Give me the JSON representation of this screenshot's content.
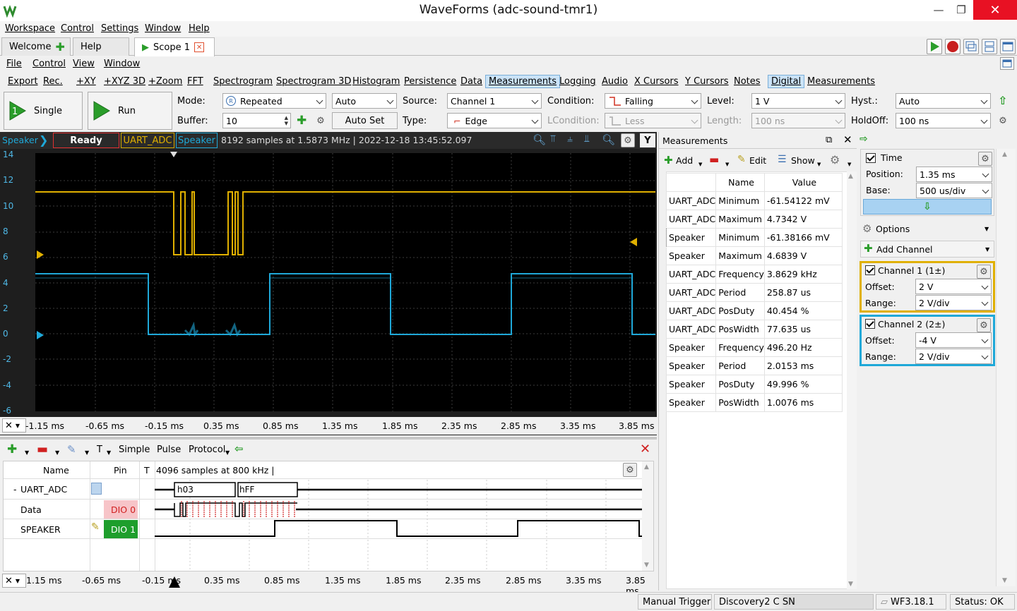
{
  "window": {
    "title": "WaveForms (adc-sound-tmr1)"
  },
  "menubar": [
    "Workspace",
    "Control",
    "Settings",
    "Window",
    "Help"
  ],
  "tabs": {
    "welcome": "Welcome",
    "help": "Help",
    "scope": "Scope 1"
  },
  "scope_menu": [
    "File",
    "Control",
    "View",
    "Window"
  ],
  "submenu": [
    "Export",
    "Rec.",
    "+XY",
    "+XYZ 3D",
    "+Zoom",
    "FFT",
    "Spectrogram",
    "Spectrogram 3D",
    "Histogram",
    "Persistence",
    "Data",
    "Measurements",
    "Logging",
    "Audio",
    "X Cursors",
    "Y Cursors",
    "Notes",
    "Digital",
    "Measurements"
  ],
  "toolbar": {
    "single": "Single",
    "run": "Run",
    "mode_label": "Mode:",
    "mode": "Repeated",
    "mode2": "Auto",
    "buffer_label": "Buffer:",
    "buffer": "10",
    "autoset": "Auto Set",
    "source_label": "Source:",
    "source": "Channel 1",
    "type_label": "Type:",
    "type": "Edge",
    "condition_label": "Condition:",
    "condition": "Falling",
    "lcondition_label": "LCondition:",
    "lcondition": "Less",
    "level_label": "Level:",
    "level": "1 V",
    "length_label": "Length:",
    "length": "100 ns",
    "hyst_label": "Hyst.:",
    "hyst": "Auto",
    "holdoff_label": "HoldOff:",
    "holdoff": "100 ns"
  },
  "scope_header": {
    "channel": "Speaker",
    "status": "Ready",
    "ch1": "UART_ADC",
    "ch2": "Speaker",
    "info": "8192 samples at 1.5873 MHz | 2022-12-18 13:45:52.097",
    "y_btn": "Y"
  },
  "y_ticks": [
    "14",
    "12",
    "10",
    "8",
    "6",
    "4",
    "2",
    "0",
    "-2",
    "-4",
    "-6"
  ],
  "x_ticks": [
    "-1.15 ms",
    "-0.65 ms",
    "-0.15 ms",
    "0.35 ms",
    "0.85 ms",
    "1.35 ms",
    "1.85 ms",
    "2.35 ms",
    "2.85 ms",
    "3.35 ms",
    "3.85 ms"
  ],
  "x_ticks_logic": [
    "1.15 ms",
    "-0.65 ms",
    "-0.15 ms",
    "0.35 ms",
    "0.85 ms",
    "1.35 ms",
    "1.85 ms",
    "2.35 ms",
    "2.85 ms",
    "3.35 ms",
    "3.85 ms"
  ],
  "measurements": {
    "title": "Measurements",
    "add": "Add",
    "edit": "Edit",
    "show": "Show",
    "col_name": "Name",
    "col_value": "Value",
    "rows": [
      [
        "UART_ADC",
        "Minimum",
        "-61.54122 mV"
      ],
      [
        "UART_ADC",
        "Maximum",
        "4.7342 V"
      ],
      [
        "Speaker",
        "Minimum",
        "-61.38166 mV"
      ],
      [
        "Speaker",
        "Maximum",
        "4.6839 V"
      ],
      [
        "UART_ADC",
        "Frequency",
        "3.8629 kHz"
      ],
      [
        "UART_ADC",
        "Period",
        "258.87 us"
      ],
      [
        "UART_ADC",
        "PosDuty",
        "40.454 %"
      ],
      [
        "UART_ADC",
        "PosWidth",
        "77.635 us"
      ],
      [
        "Speaker",
        "Frequency",
        "496.20 Hz"
      ],
      [
        "Speaker",
        "Period",
        "2.0153 ms"
      ],
      [
        "Speaker",
        "PosDuty",
        "49.996 %"
      ],
      [
        "Speaker",
        "PosWidth",
        "1.0076 ms"
      ]
    ]
  },
  "right_panel": {
    "time_label": "Time",
    "position_label": "Position:",
    "position": "1.35 ms",
    "base_label": "Base:",
    "base": "500 us/div",
    "options": "Options",
    "add_channel": "Add Channel",
    "ch1_label": "Channel 1 (1±)",
    "ch1_offset": "2 V",
    "ch1_range": "2 V/div",
    "ch2_label": "Channel 2 (2±)",
    "ch2_offset": "-4 V",
    "ch2_range": "2 V/div",
    "offset_label": "Offset:",
    "range_label": "Range:",
    "ch1_color": "#e0b000",
    "ch2_color": "#1fa8d8"
  },
  "logic": {
    "simple": "Simple",
    "pulse": "Pulse",
    "protocol": "Protocol",
    "t_btn": "T",
    "col_name": "Name",
    "col_pin": "Pin",
    "col_t": "T",
    "info": "4096 samples at 800 kHz |",
    "rows": [
      {
        "name": "UART_ADC",
        "pin": "",
        "toggle": "-"
      },
      {
        "name": "Data",
        "pin": "DIO  0"
      },
      {
        "name": "SPEAKER",
        "pin": "DIO  1"
      }
    ],
    "bytes": [
      "h03",
      "hFF"
    ]
  },
  "status": {
    "manual": "Manual Trigger",
    "device": "Discovery2 C SN",
    "version": "WF3.18.1",
    "status": "Status: OK"
  }
}
